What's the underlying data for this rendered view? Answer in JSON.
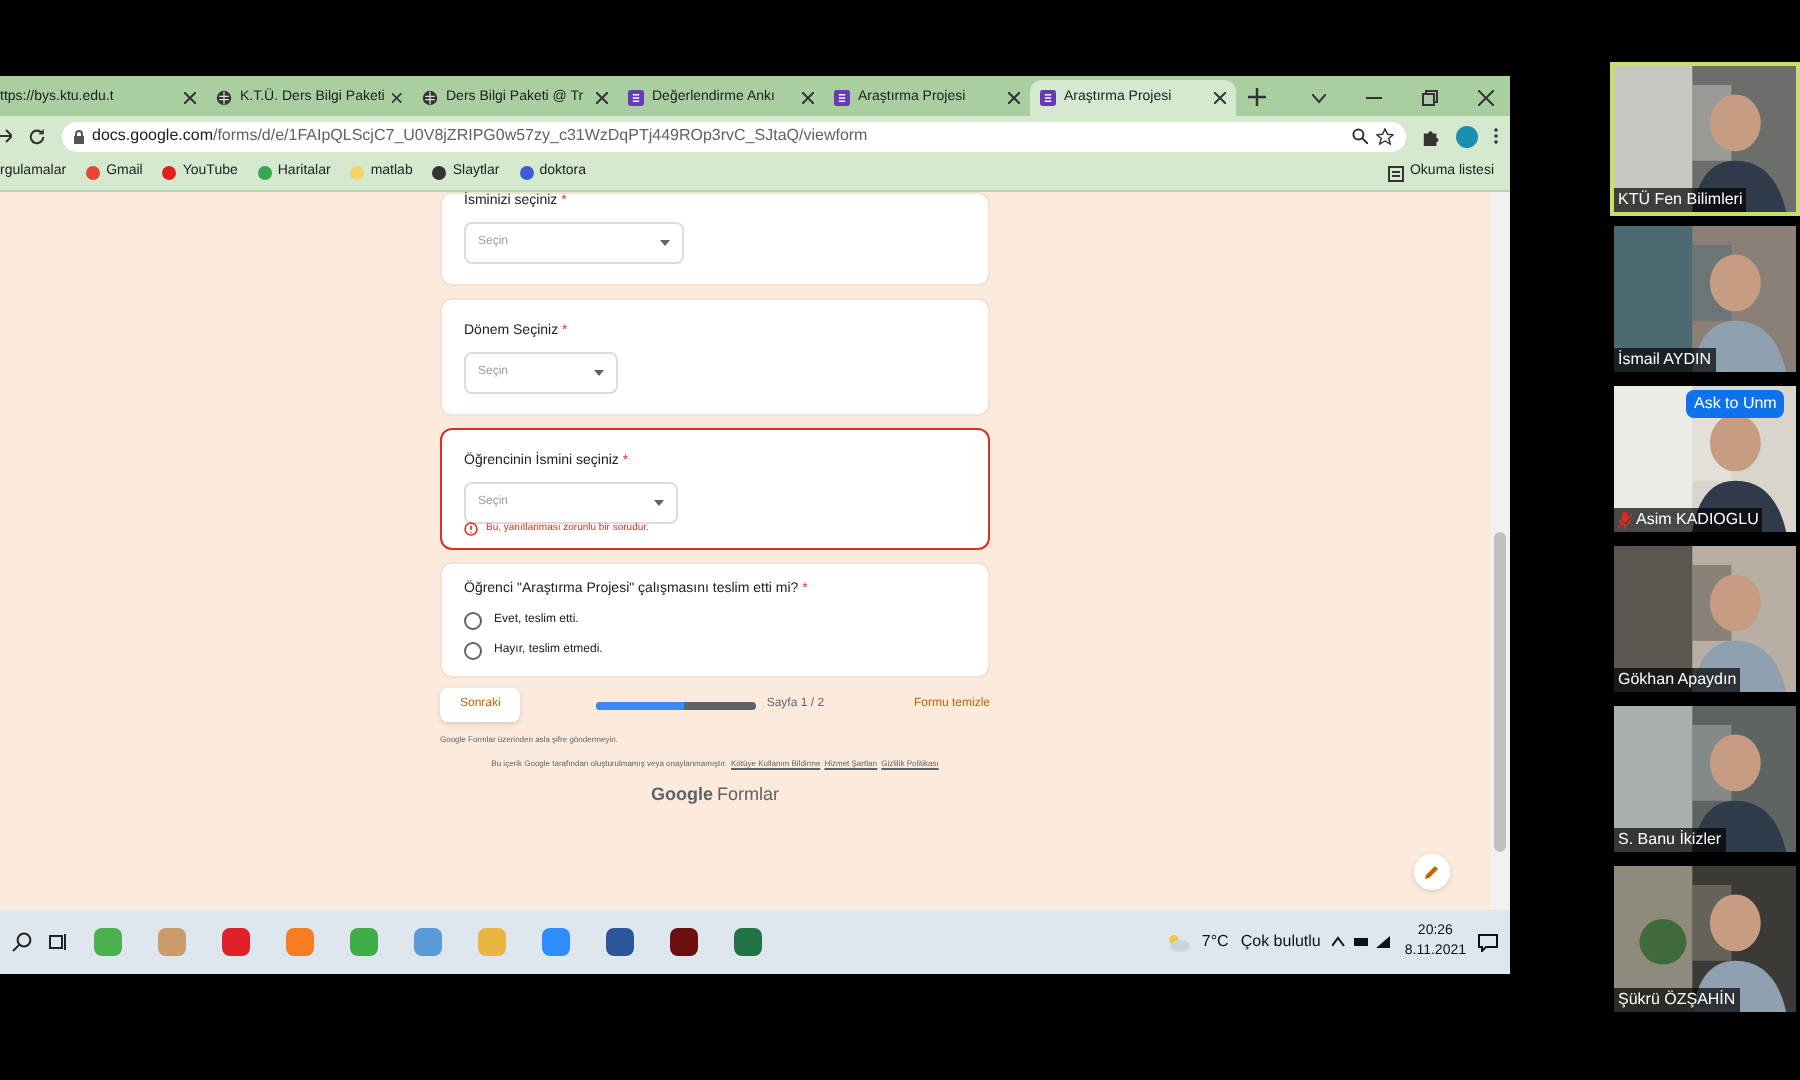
{
  "browser": {
    "tabs": [
      {
        "label": "ttps://bys.ktu.edu.t",
        "selected": false
      },
      {
        "label": "K.T.Ü. Ders Bilgi Paketi",
        "selected": false
      },
      {
        "label": "Ders Bilgi Paketi @ Tr",
        "selected": false
      },
      {
        "label": "Değerlendirme Ankı",
        "selected": false
      },
      {
        "label": "Araştırma Projesi",
        "selected": false
      },
      {
        "label": "Araştırma Projesi",
        "selected": true
      }
    ],
    "address_host": "docs.google.com",
    "address_path": "/forms/d/e/1FAIpQLScjC7_U0V8jZRIPG0w57zy_c31WzDqPTj449ROp3rvC_SJtaQ/viewform",
    "bookmarks": [
      "rgulamalar",
      "Gmail",
      "YouTube",
      "Haritalar",
      "matlab",
      "Slaytlar",
      "doktora"
    ],
    "reading_list": "Okuma listesi"
  },
  "form": {
    "questions": [
      {
        "kind": "dropdown",
        "label": "İsminizi seçiniz",
        "required_mark": "*",
        "placeholder": "Seçin"
      },
      {
        "kind": "dropdown",
        "label": "Dönem Seçiniz",
        "required_mark": "*",
        "placeholder": "Seçin"
      },
      {
        "kind": "dropdown",
        "label": "Öğrencinin İsmini seçiniz",
        "required_mark": "*",
        "placeholder": "Seçin",
        "error": "Bu, yanıtlanması zorunlu bir sorudur."
      },
      {
        "kind": "radio",
        "label": "Öğrenci \"Araştırma Projesi\" çalışmasını teslim etti mi?",
        "required_mark": "*",
        "options": [
          {
            "label": "Evet, teslim etti.",
            "selected": false
          },
          {
            "label": "Hayır, teslim etmedi.",
            "selected": false
          }
        ]
      }
    ],
    "next_button": "Sonraki",
    "progress": {
      "level": 0.55
    },
    "page_label": "Sayfa 1 / 2",
    "clear_link": "Formu temizle",
    "password_note": "Google Formlar üzerinden asla şifre göndermeyin.",
    "disclaimer": "Bu içerik Google tarafından oluşturulmamış veya onaylanmamıştır.",
    "footer_links": [
      "Kötüye Kullanım Bildirme",
      "Hizmet Şartları",
      "Gizlilik Politikası"
    ],
    "brand": "Google",
    "brand_suffix": "Formlar"
  },
  "taskbar": {
    "temperature": "7°C",
    "weather": "Çok bulutlu",
    "time": "20:26",
    "date": "8.11.2021"
  },
  "participants": [
    {
      "name": "KTÜ Fen Bilimleri",
      "speaking": true,
      "muted": false
    },
    {
      "name": "İsmail AYDIN",
      "speaking": false,
      "muted": false
    },
    {
      "name": "Asim KADIOGLU",
      "speaking": false,
      "muted": true,
      "action": "Ask to Unm"
    },
    {
      "name": "Gökhan Apaydın",
      "speaking": false,
      "muted": false
    },
    {
      "name": "S. Banu İkizler",
      "speaking": false,
      "muted": false
    },
    {
      "name": "Şükrü ÖZŞAHİN",
      "speaking": false,
      "muted": false
    }
  ]
}
